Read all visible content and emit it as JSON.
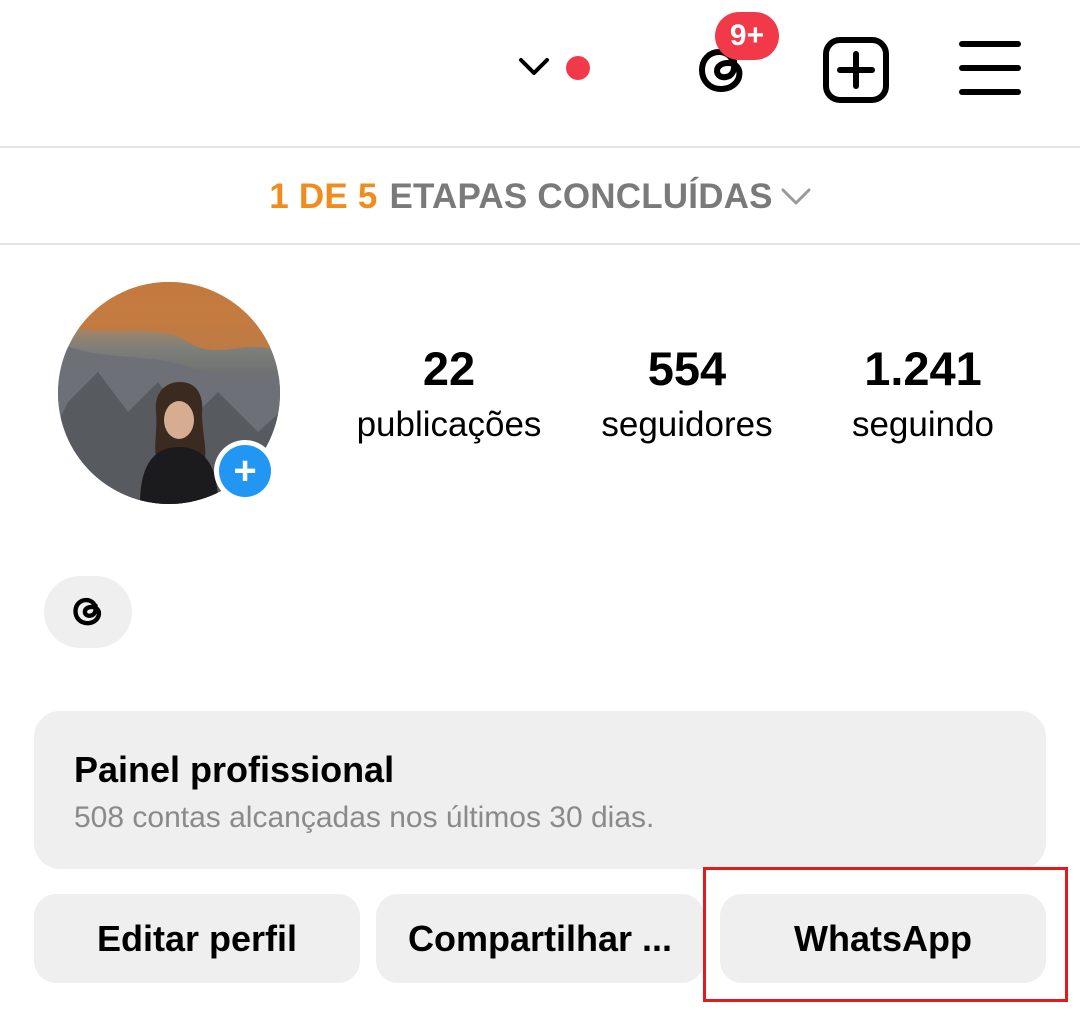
{
  "header": {
    "notification_badge": "9+",
    "icons": {
      "account_switcher": "chevron-down-icon",
      "unread_dot": "red-dot",
      "threads": "threads-icon",
      "create": "plus-square-icon",
      "menu": "hamburger-menu-icon"
    }
  },
  "onboarding": {
    "progress": "1 DE 5",
    "label": "ETAPAS CONCLUÍDAS"
  },
  "profile": {
    "stats": [
      {
        "value": "22",
        "label": "publicações"
      },
      {
        "value": "554",
        "label": "seguidores"
      },
      {
        "value": "1.241",
        "label": "seguindo"
      }
    ]
  },
  "dashboard": {
    "title": "Painel profissional",
    "subtitle": "508 contas alcançadas nos últimos 30 dias."
  },
  "actions": {
    "edit": "Editar perfil",
    "share": "Compartilhar ...",
    "whatsapp": "WhatsApp"
  },
  "colors": {
    "accent_orange": "#f08c1e",
    "badge_red": "#f2394a",
    "add_blue": "#2196f3",
    "highlight_red": "#e01b1b"
  }
}
